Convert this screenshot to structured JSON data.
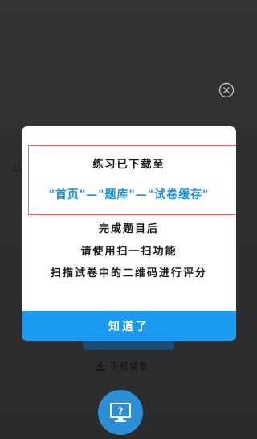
{
  "background": {
    "download_label": "下载试卷"
  },
  "dialog": {
    "line1": "练习已下载至",
    "path_text": "\"首页\"—\"题库\"—\"试卷缓存\"",
    "line3": "完成题目后",
    "line4": "请使用扫一扫功能",
    "line5": "扫描试卷中的二维码进行评分",
    "button_label": "知道了"
  },
  "icons": {
    "close": "close-circle-icon",
    "download": "download-icon",
    "help": "help-monitor-icon"
  },
  "colors": {
    "overlay": "#2e2e2e",
    "accent": "#189bf0",
    "highlight_border": "#e26a6a",
    "path_text": "#1f8fd8",
    "fab": "#2a8fd6"
  }
}
